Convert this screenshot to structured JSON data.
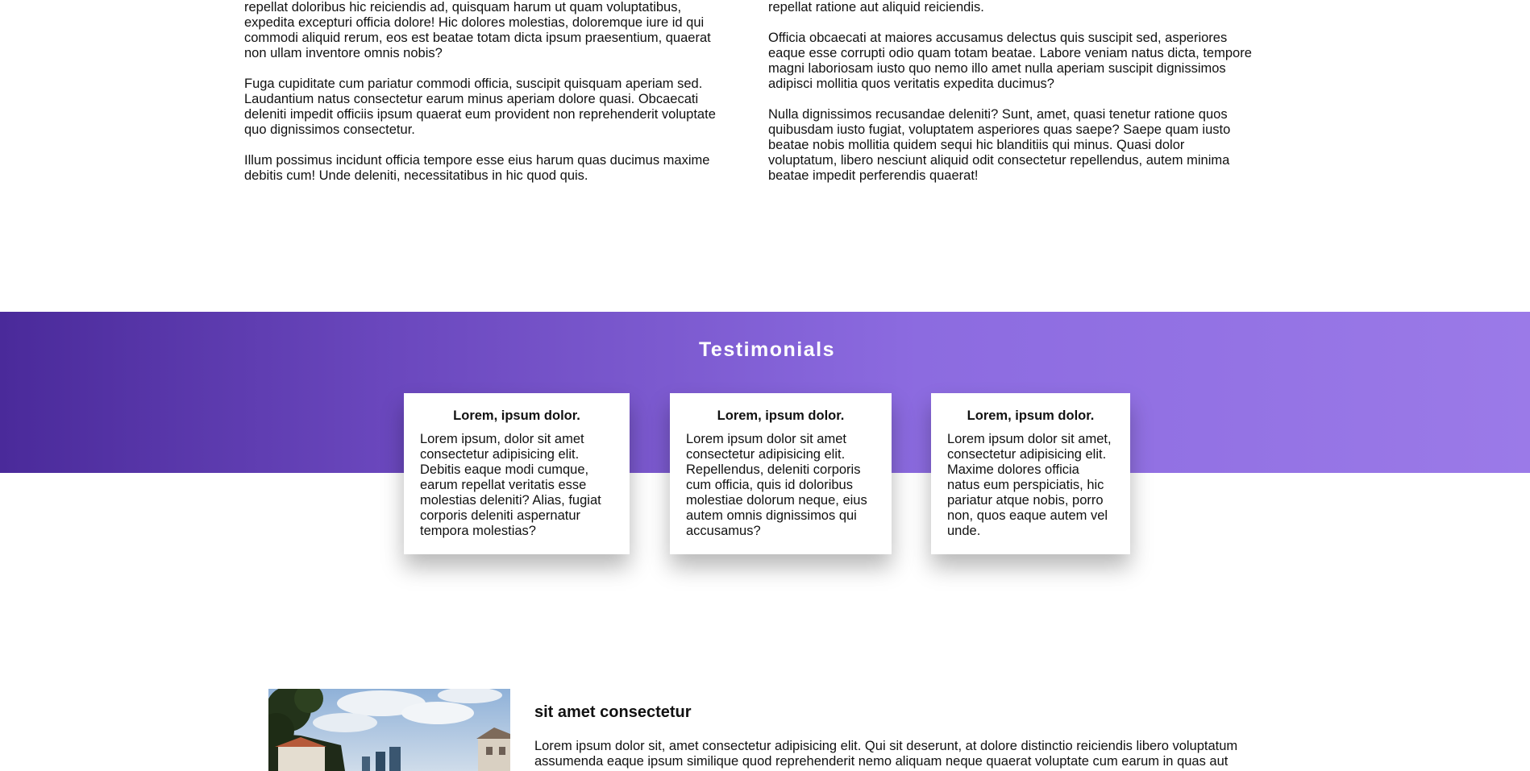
{
  "about": {
    "left": [
      "Lorem ipsum dolor sit amet consectetur adipisicing elit. Expedita iusto quam, repellat doloribus hic reiciendis ad, quisquam harum ut quam voluptatibus, expedita excepturi officia dolore! Hic dolores molestias, doloremque iure id qui commodi aliquid rerum, eos est beatae totam dicta ipsum praesentium, quaerat non ullam inventore omnis nobis?",
      "Fuga cupiditate cum pariatur commodi officia, suscipit quisquam aperiam sed. Laudantium natus consectetur earum minus aperiam dolore quasi. Obcaecati deleniti impedit officiis ipsum quaerat eum provident non reprehenderit voluptate quo dignissimos consectetur.",
      "Illum possimus incidunt officia tempore esse eius harum quas ducimus maxime debitis cum! Unde deleniti, necessitatibus in hic quod quis."
    ],
    "right": [
      "Lorem ipsum dolor sit amet consectetur adipisicing elit. Dolorem, perferendis, repellat ratione aut aliquid reiciendis.",
      "Officia obcaecati at maiores accusamus delectus quis suscipit sed, asperiores eaque esse corrupti odio quam totam beatae. Labore veniam natus dicta, tempore magni laboriosam iusto quo nemo illo amet nulla aperiam suscipit dignissimos adipisci mollitia quos veritatis expedita ducimus?",
      "Nulla dignissimos recusandae deleniti? Sunt, amet, quasi tenetur ratione quos quibusdam iusto fugiat, voluptatem asperiores quas saepe? Saepe quam iusto beatae nobis mollitia quidem sequi hic blanditiis qui minus. Quasi dolor voluptatum, libero nesciunt aliquid odit consectetur repellendus, autem minima beatae impedit perferendis quaerat!"
    ]
  },
  "testimonials": {
    "title": "Testimonials",
    "cards": [
      {
        "title": "Lorem, ipsum dolor.",
        "text": "Lorem ipsum, dolor sit amet consectetur adipisicing elit. Debitis eaque modi cumque, earum repellat veritatis esse molestias deleniti? Alias, fugiat corporis deleniti aspernatur tempora molestias?"
      },
      {
        "title": "Lorem, ipsum dolor.",
        "text": "Lorem ipsum dolor sit amet consectetur adipisicing elit. Repellendus, deleniti corporis cum officia, quis id doloribus molestiae dolorum neque, eius autem omnis dignissimos qui accusamus?"
      },
      {
        "title": "Lorem, ipsum dolor.",
        "text": "Lorem ipsum dolor sit amet, consectetur adipisicing elit. Maxime dolores officia natus eum perspiciatis, hic pariatur atque nobis, porro non, quos eaque autem vel unde."
      }
    ]
  },
  "article": {
    "title": "sit amet consectetur",
    "body": "Lorem ipsum dolor sit, amet consectetur adipisicing elit. Qui sit deserunt, at dolore distinctio reiciendis libero voluptatum assumenda eaque ipsum similique quod reprehenderit nemo aliquam neque quaerat voluptate cum earum in quas aut"
  },
  "colors": {
    "band_start": "#4a2a9a",
    "band_end": "#9b7ae8"
  }
}
